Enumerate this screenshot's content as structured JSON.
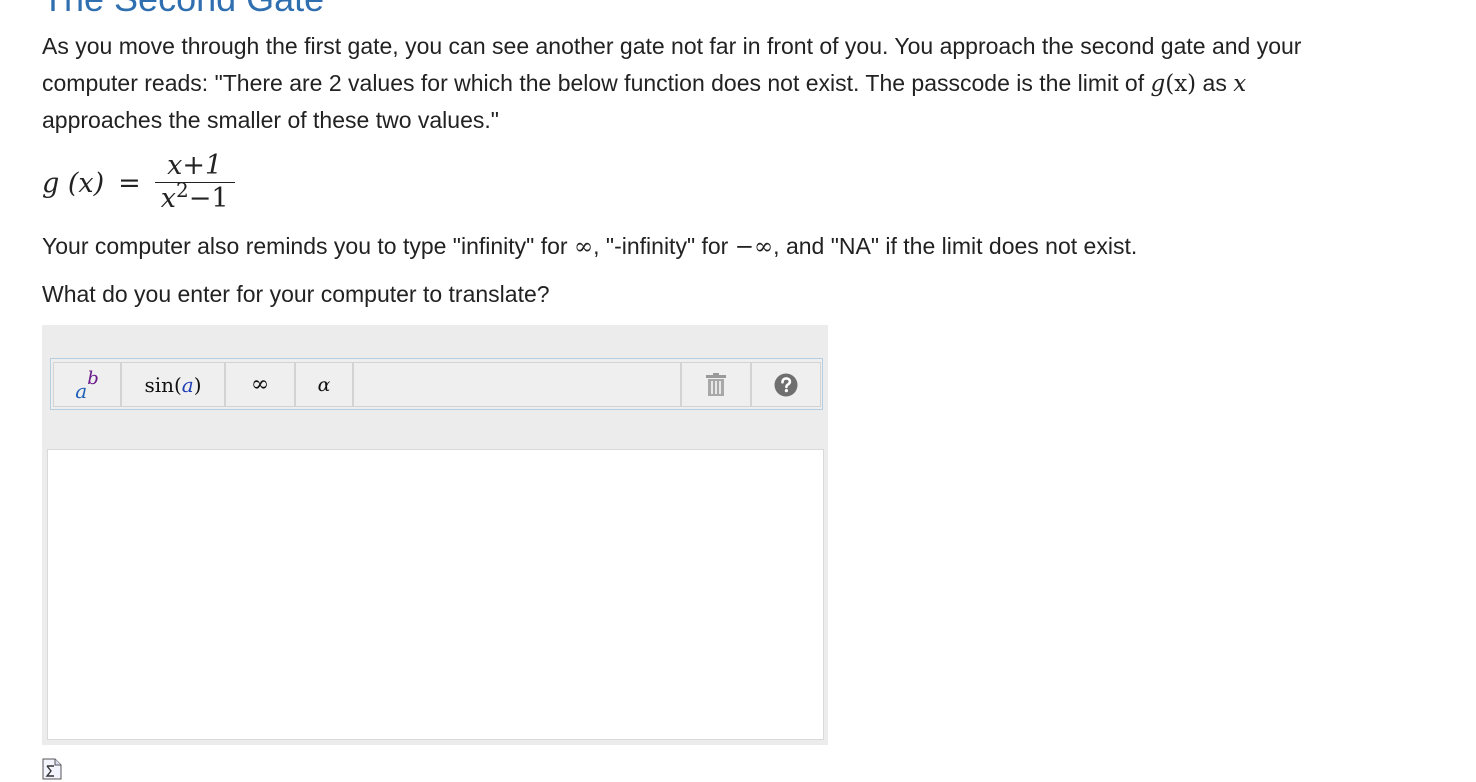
{
  "page": {
    "title": "The Second Gate"
  },
  "problem": {
    "intro_part1": "As you move through the first gate, you can see another gate not far in front of you. You approach the second gate and your computer reads: \"There are 2 values for which the below function does not exist. The passcode is the limit of ",
    "intro_math1": "g",
    "intro_math2": "(x)",
    "intro_part2": " as ",
    "intro_math3": "x",
    "intro_part3": " approaches the smaller of these two values.\"",
    "formula_lhs": "g (x)",
    "formula_eq": "=",
    "formula_num": "x+1",
    "formula_den_base": "x",
    "formula_den_exp": "2",
    "formula_den_rest": "−1",
    "reminder_p1": "Your computer also reminds you to type \"infinity\" for ",
    "reminder_inf": "∞",
    "reminder_p2": ", \"-infinity\" for ",
    "reminder_neginf": "−∞",
    "reminder_p3": ", and \"NA\" if the limit does not exist.",
    "question": "What do you enter for your computer to translate?"
  },
  "editor": {
    "toolbar": {
      "power_base": "a",
      "power_exp": "b",
      "sin_label": "sin",
      "sin_open": " (",
      "sin_arg": "a",
      "sin_close": ")",
      "infinity_label": "∞",
      "alpha_label": "α"
    },
    "answer_value": ""
  },
  "colors": {
    "title": "#2f6fb0",
    "power_base": "#1f5fb5",
    "power_exp": "#6a1a8a",
    "sin_arg": "#1f3fb5",
    "help_bg": "#6f6f6f"
  }
}
